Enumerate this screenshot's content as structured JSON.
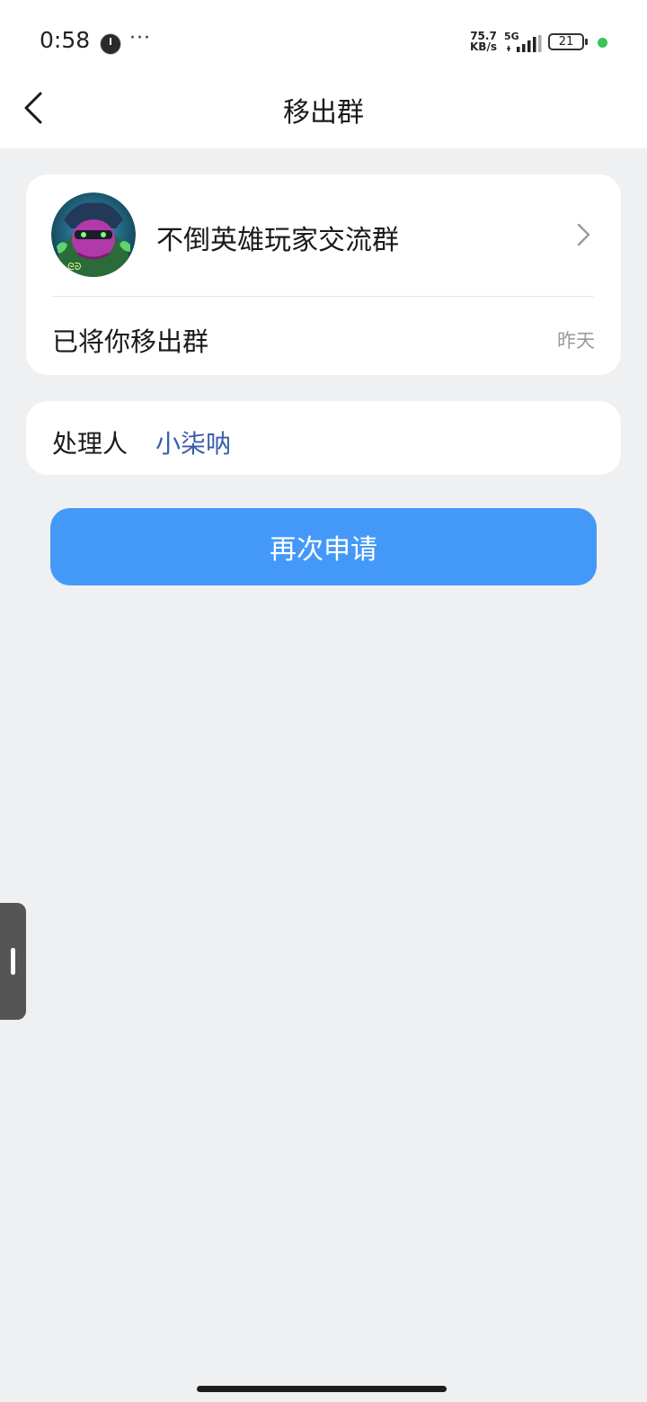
{
  "status_bar": {
    "time": "0:58",
    "more": "···",
    "net_speed_value": "75.7",
    "net_speed_unit": "KB/s",
    "network_type": "5G",
    "battery": "21",
    "icons": [
      "app-notification-icon",
      "signal-icon",
      "battery-icon",
      "active-dot-icon"
    ]
  },
  "header": {
    "title": "移出群",
    "back_icon": "chevron-left-icon"
  },
  "group_card": {
    "group_name": "不倒英雄玩家交流群",
    "message": "已将你移出群",
    "time": "昨天",
    "chevron_icon": "chevron-right-icon"
  },
  "handler_card": {
    "label": "处理人",
    "name": "小柒呐"
  },
  "actions": {
    "reapply_label": "再次申请"
  },
  "colors": {
    "primary_button": "#4499f8",
    "link_blue": "#3a5ea8",
    "background": "#eff0f2",
    "card": "#ffffff"
  }
}
